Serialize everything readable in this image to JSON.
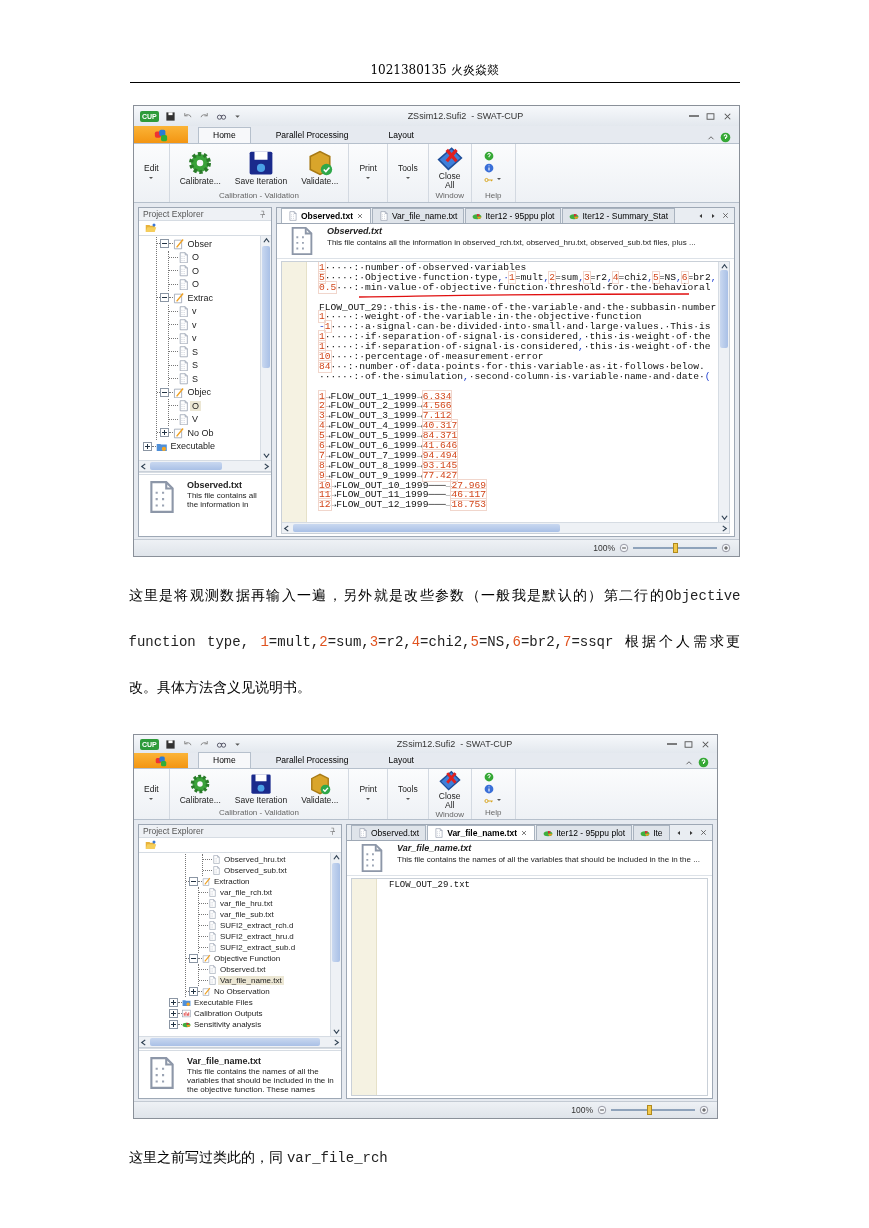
{
  "header": "1021380135 火炎焱燚",
  "blocks": [
    {
      "kind": "screenshot",
      "app_icon_label": "CUP",
      "title": "ZSsim12.Sufi2  - SWAT-CUP",
      "ribbon_tabs": [
        {
          "label": "Home",
          "selected": true
        },
        {
          "label": "Parallel Processing",
          "selected": false
        },
        {
          "label": "Layout",
          "selected": false
        }
      ],
      "ribbon_groups": [
        {
          "kind": "buttons",
          "buttons": [
            {
              "label": "Edit",
              "kind": "menu"
            }
          ]
        },
        {
          "kind": "buttons",
          "label": "Calibration - Validation",
          "buttons": [
            {
              "label": "Calibrate...",
              "kind": "command"
            },
            {
              "label": "Save Iteration",
              "kind": "command"
            },
            {
              "label": "Validate...",
              "kind": "command"
            }
          ]
        },
        {
          "kind": "buttons",
          "buttons": [
            {
              "label": "Print",
              "kind": "menu"
            }
          ]
        },
        {
          "kind": "buttons",
          "buttons": [
            {
              "label": "Tools",
              "kind": "menu"
            }
          ]
        },
        {
          "kind": "buttons",
          "label": "Window",
          "buttons": [
            {
              "label": "Close All",
              "kind": "command"
            }
          ]
        },
        {
          "kind": "icons",
          "label": "Help"
        }
      ],
      "explorer": {
        "title": "Project Explorer",
        "tree": [
          {
            "kind": "branch",
            "children": [
              {
                "label": "Obser",
                "kind": "group",
                "expanded": true,
                "selected": false,
                "children": [
                  {
                    "label": "O",
                    "kind": "file",
                    "selected": false
                  },
                  {
                    "label": "O",
                    "kind": "file",
                    "selected": false
                  },
                  {
                    "label": "O",
                    "kind": "file",
                    "selected": false
                  }
                ]
              },
              {
                "label": "Extrac",
                "kind": "group",
                "expanded": true,
                "selected": false,
                "children": [
                  {
                    "label": "v",
                    "kind": "file",
                    "selected": false
                  },
                  {
                    "label": "v",
                    "kind": "file",
                    "selected": false
                  },
                  {
                    "label": "v",
                    "kind": "file",
                    "selected": false
                  },
                  {
                    "label": "S",
                    "kind": "file",
                    "selected": false
                  },
                  {
                    "label": "S",
                    "kind": "file",
                    "selected": false
                  },
                  {
                    "label": "S",
                    "kind": "file",
                    "selected": false
                  }
                ]
              },
              {
                "label": "Objec",
                "kind": "group",
                "expanded": true,
                "selected": false,
                "children": [
                  {
                    "label": "O",
                    "kind": "file",
                    "selected": true
                  },
                  {
                    "label": "V",
                    "kind": "file",
                    "selected": false
                  }
                ]
              },
              {
                "label": "No Ob",
                "kind": "group",
                "expanded": false,
                "selected": false
              }
            ]
          },
          {
            "label": "Executable",
            "kind": "executable",
            "expanded": false,
            "selected": false
          }
        ],
        "info": {
          "title": "Observed.txt",
          "text": "This file contains all the information in"
        }
      },
      "doc_tabs": [
        {
          "label": "Observed.txt",
          "kind": "doc",
          "selected": true
        },
        {
          "label": "Var_file_name.txt",
          "kind": "doc",
          "selected": false
        },
        {
          "label": "Iter12 - 95ppu plot",
          "kind": "plot",
          "selected": false
        },
        {
          "label": "Iter12 - Summary_Stat",
          "kind": "plot",
          "selected": false
        }
      ],
      "document": {
        "title": "Observed.txt",
        "description": "This file contains all the information in observed_rch.txt, observed_hru.txt, observed_sub.txt files, plus ...",
        "lines": [
          {
            "kind": "code",
            "underlined": false,
            "segments": [
              {
                "kind": "num",
                "text": "1"
              },
              {
                "kind": "text",
                "text": "·····:·number·of·observed·variables"
              }
            ]
          },
          {
            "kind": "code",
            "underlined": false,
            "segments": [
              {
                "kind": "num",
                "text": "5"
              },
              {
                "kind": "text",
                "text": "·····:·Objective·function·type"
              },
              {
                "kind": "sign",
                "text": ",·"
              },
              {
                "kind": "num",
                "text": "1"
              },
              {
                "kind": "text",
                "text": "=mult"
              },
              {
                "kind": "sign",
                "text": ","
              },
              {
                "kind": "num",
                "text": "2"
              },
              {
                "kind": "text",
                "text": "=sum"
              },
              {
                "kind": "sign",
                "text": ","
              },
              {
                "kind": "num",
                "text": "3"
              },
              {
                "kind": "text",
                "text": "=r2"
              },
              {
                "kind": "sign",
                "text": ","
              },
              {
                "kind": "num",
                "text": "4"
              },
              {
                "kind": "text",
                "text": "=chi2"
              },
              {
                "kind": "sign",
                "text": ","
              },
              {
                "kind": "num",
                "text": "5"
              },
              {
                "kind": "text",
                "text": "=NS"
              },
              {
                "kind": "sign",
                "text": ","
              },
              {
                "kind": "num",
                "text": "6"
              },
              {
                "kind": "text",
                "text": "=br2"
              },
              {
                "kind": "sign",
                "text": ","
              }
            ]
          },
          {
            "kind": "code",
            "underlined": true,
            "segments": [
              {
                "kind": "num",
                "text": "0.5"
              },
              {
                "kind": "text",
                "text": "···:·min·value·of·objective·function·threshold·for·the·behavioral"
              }
            ]
          },
          {
            "kind": "blank"
          },
          {
            "kind": "code",
            "underlined": false,
            "segments": [
              {
                "kind": "text",
                "text": "FLOW_OUT_29:·this·is·the·name·of·the·variable·and·the·subbasin·number"
              }
            ]
          },
          {
            "kind": "code",
            "underlined": false,
            "segments": [
              {
                "kind": "num",
                "text": "1"
              },
              {
                "kind": "text",
                "text": "·····:·weight·of·the·variable·in·the·objective·function"
              }
            ]
          },
          {
            "kind": "code",
            "underlined": false,
            "segments": [
              {
                "kind": "sign",
                "text": "-"
              },
              {
                "kind": "num",
                "text": "1"
              },
              {
                "kind": "text",
                "text": "····:·a·signal·can·be·divided·into·small·and·large·values.·This·is"
              }
            ]
          },
          {
            "kind": "code",
            "underlined": false,
            "segments": [
              {
                "kind": "num",
                "text": "1"
              },
              {
                "kind": "text",
                "text": "·····:·if·separation·of·signal·is·considered"
              },
              {
                "kind": "sign",
                "text": ","
              },
              {
                "kind": "text",
                "text": "·this·is·weight·of·the"
              }
            ]
          },
          {
            "kind": "code",
            "underlined": false,
            "segments": [
              {
                "kind": "num",
                "text": "1"
              },
              {
                "kind": "text",
                "text": "·····:·if·separation·of·signal·is·considered"
              },
              {
                "kind": "sign",
                "text": ","
              },
              {
                "kind": "text",
                "text": "·this·is·weight·of·the"
              }
            ]
          },
          {
            "kind": "code",
            "underlined": false,
            "segments": [
              {
                "kind": "num",
                "text": "10"
              },
              {
                "kind": "text",
                "text": "····:·percentage·of·measurement·error"
              }
            ]
          },
          {
            "kind": "code",
            "underlined": false,
            "segments": [
              {
                "kind": "num",
                "text": "84"
              },
              {
                "kind": "text",
                "text": "···:·number·of·data·points·for·this·variable·as·it·follows·below."
              }
            ]
          },
          {
            "kind": "code",
            "underlined": false,
            "segments": [
              {
                "kind": "text",
                "text": "······:·of·the·simulation"
              },
              {
                "kind": "sign",
                "text": ","
              },
              {
                "kind": "text",
                "text": "·second·column·is·variable·name·and·date·"
              },
              {
                "kind": "sign",
                "text": "("
              }
            ]
          },
          {
            "kind": "blank"
          },
          {
            "kind": "code",
            "underlined": false,
            "segments": [
              {
                "kind": "num",
                "text": "1"
              },
              {
                "kind": "text",
                "text": "→FLOW_OUT_1_1999→"
              },
              {
                "kind": "num",
                "text": "6.334"
              }
            ]
          },
          {
            "kind": "code",
            "underlined": false,
            "segments": [
              {
                "kind": "num",
                "text": "2"
              },
              {
                "kind": "text",
                "text": "→FLOW_OUT_2_1999→"
              },
              {
                "kind": "num",
                "text": "4.566"
              }
            ]
          },
          {
            "kind": "code",
            "underlined": false,
            "segments": [
              {
                "kind": "num",
                "text": "3"
              },
              {
                "kind": "text",
                "text": "→FLOW_OUT_3_1999→"
              },
              {
                "kind": "num",
                "text": "7.112"
              }
            ]
          },
          {
            "kind": "code",
            "underlined": false,
            "segments": [
              {
                "kind": "num",
                "text": "4"
              },
              {
                "kind": "text",
                "text": "→FLOW_OUT_4_1999→"
              },
              {
                "kind": "num",
                "text": "40.317"
              }
            ]
          },
          {
            "kind": "code",
            "underlined": false,
            "segments": [
              {
                "kind": "num",
                "text": "5"
              },
              {
                "kind": "text",
                "text": "→FLOW_OUT_5_1999→"
              },
              {
                "kind": "num",
                "text": "84.371"
              }
            ]
          },
          {
            "kind": "code",
            "underlined": false,
            "segments": [
              {
                "kind": "num",
                "text": "6"
              },
              {
                "kind": "text",
                "text": "→FLOW_OUT_6_1999→"
              },
              {
                "kind": "num",
                "text": "41.646"
              }
            ]
          },
          {
            "kind": "code",
            "underlined": false,
            "segments": [
              {
                "kind": "num",
                "text": "7"
              },
              {
                "kind": "text",
                "text": "→FLOW_OUT_7_1999→"
              },
              {
                "kind": "num",
                "text": "94.494"
              }
            ]
          },
          {
            "kind": "code",
            "underlined": false,
            "segments": [
              {
                "kind": "num",
                "text": "8"
              },
              {
                "kind": "text",
                "text": "→FLOW_OUT_8_1999→"
              },
              {
                "kind": "num",
                "text": "93.145"
              }
            ]
          },
          {
            "kind": "code",
            "underlined": false,
            "segments": [
              {
                "kind": "num",
                "text": "9"
              },
              {
                "kind": "text",
                "text": "→FLOW_OUT_9_1999→"
              },
              {
                "kind": "num",
                "text": "77.427"
              }
            ]
          },
          {
            "kind": "code",
            "underlined": false,
            "segments": [
              {
                "kind": "num",
                "text": "10"
              },
              {
                "kind": "text",
                "text": "→FLOW_OUT_10_1999───→"
              },
              {
                "kind": "num",
                "text": "27.969"
              }
            ]
          },
          {
            "kind": "code",
            "underlined": false,
            "segments": [
              {
                "kind": "num",
                "text": "11"
              },
              {
                "kind": "text",
                "text": "→FLOW_OUT_11_1999───→"
              },
              {
                "kind": "num",
                "text": "46.117"
              }
            ]
          },
          {
            "kind": "code",
            "underlined": false,
            "segments": [
              {
                "kind": "num",
                "text": "12"
              },
              {
                "kind": "text",
                "text": "→FLOW_OUT_12_1999───→"
              },
              {
                "kind": "num",
                "text": "18.753"
              }
            ]
          }
        ]
      },
      "status": {
        "zoom": "100%",
        "level": 0.5
      }
    },
    {
      "kind": "paragraph",
      "segments": [
        {
          "kind": "cjk",
          "text": "这里是将观测数据再输入一遍，另外就是改些参数（一般我是默认的）第二行的"
        },
        {
          "kind": "mono",
          "text": "Objective function type, "
        },
        {
          "kind": "num",
          "text": "1"
        },
        {
          "kind": "mono",
          "text": "=mult,"
        },
        {
          "kind": "num",
          "text": "2"
        },
        {
          "kind": "mono",
          "text": "=sum,"
        },
        {
          "kind": "num",
          "text": "3"
        },
        {
          "kind": "mono",
          "text": "=r2,"
        },
        {
          "kind": "num",
          "text": "4"
        },
        {
          "kind": "mono",
          "text": "=chi2,"
        },
        {
          "kind": "num",
          "text": "5"
        },
        {
          "kind": "mono",
          "text": "=NS,"
        },
        {
          "kind": "num",
          "text": "6"
        },
        {
          "kind": "mono",
          "text": "=br2,"
        },
        {
          "kind": "num",
          "text": "7"
        },
        {
          "kind": "mono",
          "text": "=ssqr "
        },
        {
          "kind": "cjk",
          "text": " 根据个人需求更改。具体方法含义见说明书。"
        }
      ]
    },
    {
      "kind": "screenshot",
      "app_icon_label": "CUP",
      "title": "ZSsim12.Sufi2  - SWAT-CUP",
      "ribbon_tabs": [
        {
          "label": "Home",
          "selected": true
        },
        {
          "label": "Parallel Processing",
          "selected": false
        },
        {
          "label": "Layout",
          "selected": false
        }
      ],
      "ribbon_groups": [
        {
          "kind": "buttons",
          "buttons": [
            {
              "label": "Edit",
              "kind": "menu"
            }
          ]
        },
        {
          "kind": "buttons",
          "label": "Calibration - Validation",
          "buttons": [
            {
              "label": "Calibrate...",
              "kind": "command"
            },
            {
              "label": "Save Iteration",
              "kind": "command"
            },
            {
              "label": "Validate...",
              "kind": "command"
            }
          ]
        },
        {
          "kind": "buttons",
          "buttons": [
            {
              "label": "Print",
              "kind": "menu"
            }
          ]
        },
        {
          "kind": "buttons",
          "buttons": [
            {
              "label": "Tools",
              "kind": "menu"
            }
          ]
        },
        {
          "kind": "buttons",
          "label": "Window",
          "buttons": [
            {
              "label": "Close All",
              "kind": "command"
            }
          ]
        },
        {
          "kind": "icons",
          "label": "Help"
        }
      ],
      "explorer": {
        "title": "Project Explorer",
        "tree": [
          {
            "kind": "branch",
            "children": [
              {
                "kind": "branch",
                "children": [
                  {
                    "label": "Observed_hru.txt",
                    "kind": "file",
                    "selected": false
                  },
                  {
                    "label": "Observed_sub.txt",
                    "kind": "file",
                    "selected": false
                  }
                ]
              },
              {
                "label": "Extraction",
                "kind": "group",
                "expanded": true,
                "selected": false,
                "children": [
                  {
                    "label": "var_file_rch.txt",
                    "kind": "file",
                    "selected": false
                  },
                  {
                    "label": "var_file_hru.txt",
                    "kind": "file",
                    "selected": false
                  },
                  {
                    "label": "var_file_sub.txt",
                    "kind": "file",
                    "selected": false
                  },
                  {
                    "label": "SUFI2_extract_rch.d",
                    "kind": "file",
                    "selected": false
                  },
                  {
                    "label": "SUFI2_extract_hru.d",
                    "kind": "file",
                    "selected": false
                  },
                  {
                    "label": "SUFI2_extract_sub.d",
                    "kind": "file",
                    "selected": false
                  }
                ]
              },
              {
                "label": "Objective Function",
                "kind": "group",
                "expanded": true,
                "selected": false,
                "children": [
                  {
                    "label": "Observed.txt",
                    "kind": "file",
                    "selected": false
                  },
                  {
                    "label": "Var_file_name.txt",
                    "kind": "file",
                    "selected": true
                  }
                ]
              },
              {
                "label": "No Observation",
                "kind": "group",
                "expanded": false,
                "selected": false
              }
            ]
          },
          {
            "label": "Executable Files",
            "kind": "executable",
            "expanded": false,
            "selected": false
          },
          {
            "label": "Calibration Outputs",
            "kind": "outputs",
            "expanded": false,
            "selected": false
          },
          {
            "label": "Sensitivity analysis",
            "kind": "sensitivity",
            "expanded": false,
            "selected": false
          }
        ],
        "info": {
          "title": "Var_file_name.txt",
          "text": "This file contains the names of all the variables that should be included in the in the objective function. These names"
        }
      },
      "doc_tabs": [
        {
          "label": "Observed.txt",
          "kind": "doc",
          "selected": false
        },
        {
          "label": "Var_file_name.txt",
          "kind": "doc",
          "selected": true
        },
        {
          "label": "Iter12 - 95ppu plot",
          "kind": "plot",
          "selected": false
        },
        {
          "label": "Ite",
          "kind": "plot",
          "selected": false
        }
      ],
      "document": {
        "title": "Var_file_name.txt",
        "description": "This file contains the names of all the variables that should be included in the in the ...",
        "lines": [
          {
            "kind": "code",
            "underlined": false,
            "segments": [
              {
                "kind": "text",
                "text": "FLOW_OUT_29.txt"
              }
            ]
          }
        ]
      },
      "status": {
        "zoom": "100%",
        "level": 0.45
      }
    },
    {
      "kind": "paragraph",
      "segments": [
        {
          "kind": "cjk",
          "text": "这里之前写过类此的，同 "
        },
        {
          "kind": "mono",
          "text": "var_file_rch"
        }
      ]
    }
  ]
}
